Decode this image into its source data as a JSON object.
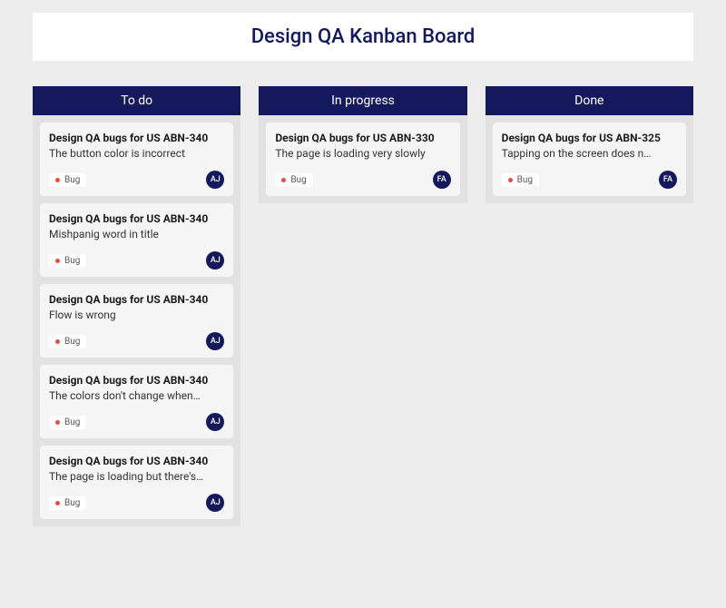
{
  "title": "Design QA Kanban Board",
  "colors": {
    "accent": "#14195c",
    "bug_dot": "#e74c3c"
  },
  "columns": [
    {
      "title": "To do",
      "cards": [
        {
          "title": "Design QA bugs for US ABN-340",
          "description": "The button color is incorrect",
          "tag": "Bug",
          "assignee": "AJ"
        },
        {
          "title": "Design QA bugs for US ABN-340",
          "description": "Mishpanig word in title",
          "tag": "Bug",
          "assignee": "AJ"
        },
        {
          "title": "Design QA bugs for US ABN-340",
          "description": "Flow is wrong",
          "tag": "Bug",
          "assignee": "AJ"
        },
        {
          "title": "Design QA bugs for US ABN-340",
          "description": "The colors don't change when…",
          "tag": "Bug",
          "assignee": "AJ"
        },
        {
          "title": "Design QA bugs for US ABN-340",
          "description": "The page is loading but there's…",
          "tag": "Bug",
          "assignee": "AJ"
        }
      ]
    },
    {
      "title": "In progress",
      "cards": [
        {
          "title": "Design QA bugs for US ABN-330",
          "description": "The page is loading very slowly",
          "tag": "Bug",
          "assignee": "FA"
        }
      ]
    },
    {
      "title": "Done",
      "cards": [
        {
          "title": "Design QA bugs for US ABN-325",
          "description": "Tapping on the screen does n…",
          "tag": "Bug",
          "assignee": "FA"
        }
      ]
    }
  ]
}
